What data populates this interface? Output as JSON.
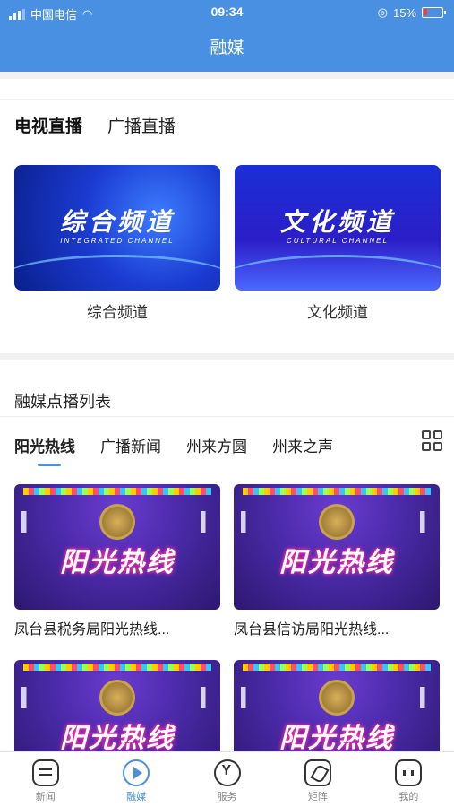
{
  "status": {
    "carrier": "中国电信",
    "time": "09:34",
    "battery": "15%",
    "battery_level": 0.15
  },
  "header": {
    "title": "融媒"
  },
  "live_tabs": [
    "电视直播",
    "广播直播"
  ],
  "channels": [
    {
      "title_overlay": "综合频道",
      "subtitle_overlay": "INTEGRATED CHANNEL",
      "label": "综合频道"
    },
    {
      "title_overlay": "文化频道",
      "subtitle_overlay": "CULTURAL CHANNEL",
      "label": "文化频道"
    }
  ],
  "vod": {
    "section_title": "融媒点播列表",
    "tabs": [
      "阳光热线",
      "广播新闻",
      "州来方圆",
      "州来之声"
    ],
    "items": [
      {
        "overlay": "阳光热线",
        "label": "凤台县税务局阳光热线..."
      },
      {
        "overlay": "阳光热线",
        "label": "凤台县信访局阳光热线..."
      },
      {
        "overlay": "阳光热线",
        "label": ""
      },
      {
        "overlay": "阳光热线",
        "label": ""
      }
    ]
  },
  "bottom_nav": [
    {
      "label": "新闻",
      "icon": "news-icon"
    },
    {
      "label": "融媒",
      "icon": "play-icon"
    },
    {
      "label": "服务",
      "icon": "service-icon"
    },
    {
      "label": "矩阵",
      "icon": "matrix-icon"
    },
    {
      "label": "我的",
      "icon": "profile-icon"
    }
  ],
  "colors": {
    "accent": "#4a90e2",
    "battery_low": "#ff3b30"
  }
}
